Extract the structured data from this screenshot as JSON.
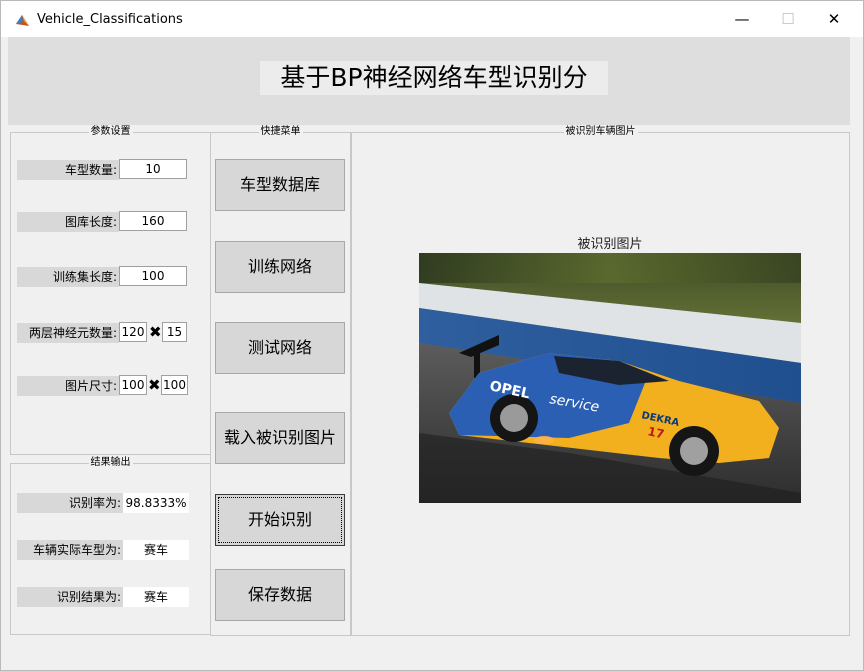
{
  "window": {
    "title": "Vehicle_Classifications"
  },
  "header": {
    "title": "基于BP神经网络车型识别分"
  },
  "params": {
    "title": "参数设置",
    "num_classes_label": "车型数量:",
    "num_classes": "10",
    "lib_length_label": "图库长度:",
    "lib_length": "160",
    "train_length_label": "训练集长度:",
    "train_length": "100",
    "neurons_label": "两层神经元数量:",
    "neurons_1": "120",
    "neurons_2": "15",
    "img_size_label": "图片尺寸:",
    "img_w": "100",
    "img_h": "100",
    "times_glyph": "✖"
  },
  "menu": {
    "title": "快捷菜单",
    "buttons": [
      "车型数据库",
      "训练网络",
      "测试网络",
      "载入被识别图片",
      "开始识别",
      "保存数据"
    ]
  },
  "results": {
    "title": "结果输出",
    "rate_label": "识别率为:",
    "rate": "98.8333%",
    "actual_label": "车辆实际车型为:",
    "actual": "赛车",
    "result_label": "识别结果为:",
    "result": "赛车"
  },
  "image_panel": {
    "title": "被识别车辆图片",
    "axes_title": "被识别图片",
    "car_text_1": "OPEL",
    "car_text_2": "service",
    "car_text_3": "DEKRA",
    "car_number": "17"
  },
  "colors": {
    "car_yellow": "#f2b01e",
    "car_blue": "#2b5fb3",
    "track": "#4a4a4a",
    "grass": "#4f6e2c"
  }
}
